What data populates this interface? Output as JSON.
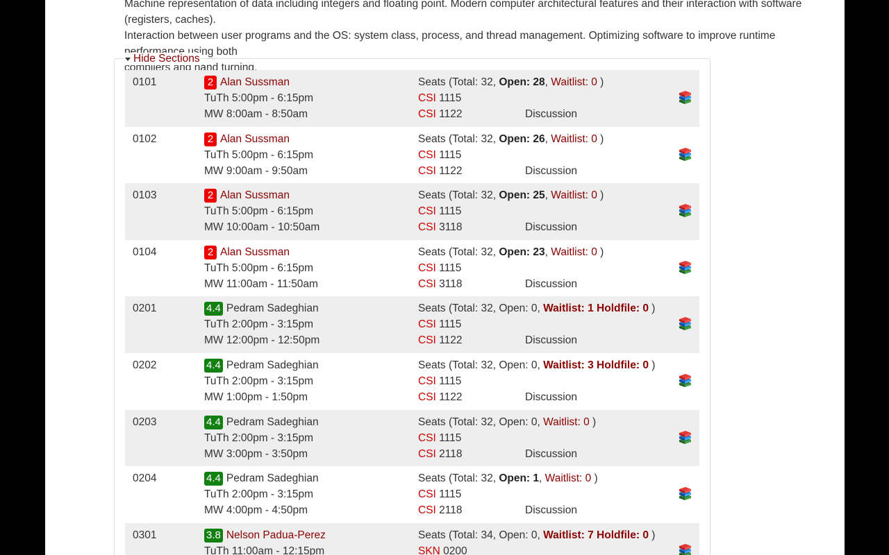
{
  "description": [
    "Machine representation of data including integers and floating point. Modern computer architectural features and their interaction with software (registers, caches).",
    "Interaction between user programs and the OS: system class, process, and thread management. Optimizing software to improve runtime performance using both",
    "compilers and hand turning."
  ],
  "toggle_label": "Hide Sections",
  "labels": {
    "seats_prefix": "Seats (Total: ",
    "open": "Open: ",
    "open_plain": "Open: ",
    "waitlist": "Waitlist: ",
    "holdfile": " Holdfile: ",
    "discussion": "Discussion"
  },
  "colors": {
    "badge_red": "#ee0000",
    "badge_green": "#128112",
    "link": "#8b0000",
    "building": "#cc0000"
  },
  "sections": [
    {
      "id": "0101",
      "rating": "2",
      "rating_color": "red",
      "instructor": "Alan Sussman",
      "instructor_link": true,
      "lecture": "TuTh 5:00pm - 6:15pm",
      "discussion_time": "MW 8:00am - 8:50am",
      "total": "32",
      "open": "28",
      "open_bold": true,
      "waitlist": "0",
      "holdfile": null,
      "lec_bldg": "CSI",
      "lec_room": "1115",
      "dis_bldg": "CSI",
      "dis_room": "1122",
      "icon": "books-icon"
    },
    {
      "id": "0102",
      "rating": "2",
      "rating_color": "red",
      "instructor": "Alan Sussman",
      "instructor_link": true,
      "lecture": "TuTh 5:00pm - 6:15pm",
      "discussion_time": "MW 9:00am - 9:50am",
      "total": "32",
      "open": "26",
      "open_bold": true,
      "waitlist": "0",
      "holdfile": null,
      "lec_bldg": "CSI",
      "lec_room": "1115",
      "dis_bldg": "CSI",
      "dis_room": "1122",
      "icon": "books-icon"
    },
    {
      "id": "0103",
      "rating": "2",
      "rating_color": "red",
      "instructor": "Alan Sussman",
      "instructor_link": true,
      "lecture": "TuTh 5:00pm - 6:15pm",
      "discussion_time": "MW 10:00am - 10:50am",
      "total": "32",
      "open": "25",
      "open_bold": true,
      "waitlist": "0",
      "holdfile": null,
      "lec_bldg": "CSI",
      "lec_room": "1115",
      "dis_bldg": "CSI",
      "dis_room": "3118",
      "icon": "books-icon"
    },
    {
      "id": "0104",
      "rating": "2",
      "rating_color": "red",
      "instructor": "Alan Sussman",
      "instructor_link": true,
      "lecture": "TuTh 5:00pm - 6:15pm",
      "discussion_time": "MW 11:00am - 11:50am",
      "total": "32",
      "open": "23",
      "open_bold": true,
      "waitlist": "0",
      "holdfile": null,
      "lec_bldg": "CSI",
      "lec_room": "1115",
      "dis_bldg": "CSI",
      "dis_room": "3118",
      "icon": "books-icon"
    },
    {
      "id": "0201",
      "rating": "4.4",
      "rating_color": "green",
      "instructor": "Pedram Sadeghian",
      "instructor_link": false,
      "lecture": "TuTh 2:00pm - 3:15pm",
      "discussion_time": "MW 12:00pm - 12:50pm",
      "total": "32",
      "open": "0",
      "open_bold": false,
      "waitlist": "1",
      "holdfile": "0",
      "lec_bldg": "CSI",
      "lec_room": "1115",
      "dis_bldg": "CSI",
      "dis_room": "1122",
      "icon": "books-icon"
    },
    {
      "id": "0202",
      "rating": "4.4",
      "rating_color": "green",
      "instructor": "Pedram Sadeghian",
      "instructor_link": false,
      "lecture": "TuTh 2:00pm - 3:15pm",
      "discussion_time": "MW 1:00pm - 1:50pm",
      "total": "32",
      "open": "0",
      "open_bold": false,
      "waitlist": "3",
      "holdfile": "0",
      "lec_bldg": "CSI",
      "lec_room": "1115",
      "dis_bldg": "CSI",
      "dis_room": "1122",
      "icon": "books-icon"
    },
    {
      "id": "0203",
      "rating": "4.4",
      "rating_color": "green",
      "instructor": "Pedram Sadeghian",
      "instructor_link": false,
      "lecture": "TuTh 2:00pm - 3:15pm",
      "discussion_time": "MW 3:00pm - 3:50pm",
      "total": "32",
      "open": "0",
      "open_bold": false,
      "waitlist": "0",
      "holdfile": null,
      "lec_bldg": "CSI",
      "lec_room": "1115",
      "dis_bldg": "CSI",
      "dis_room": "2118",
      "icon": "books-icon"
    },
    {
      "id": "0204",
      "rating": "4.4",
      "rating_color": "green",
      "instructor": "Pedram Sadeghian",
      "instructor_link": false,
      "lecture": "TuTh 2:00pm - 3:15pm",
      "discussion_time": "MW 4:00pm - 4:50pm",
      "total": "32",
      "open": "1",
      "open_bold": true,
      "waitlist": "0",
      "holdfile": null,
      "lec_bldg": "CSI",
      "lec_room": "1115",
      "dis_bldg": "CSI",
      "dis_room": "2118",
      "icon": "books-icon"
    },
    {
      "id": "0301",
      "rating": "3.8",
      "rating_color": "green",
      "instructor": "Nelson Padua-Perez",
      "instructor_link": true,
      "lecture": "TuTh 11:00am - 12:15pm",
      "discussion_time": "",
      "total": "34",
      "open": "0",
      "open_bold": false,
      "waitlist": "7",
      "holdfile": "0",
      "lec_bldg": "SKN",
      "lec_room": "0200",
      "dis_bldg": "",
      "dis_room": "",
      "icon": "books-icon"
    }
  ]
}
